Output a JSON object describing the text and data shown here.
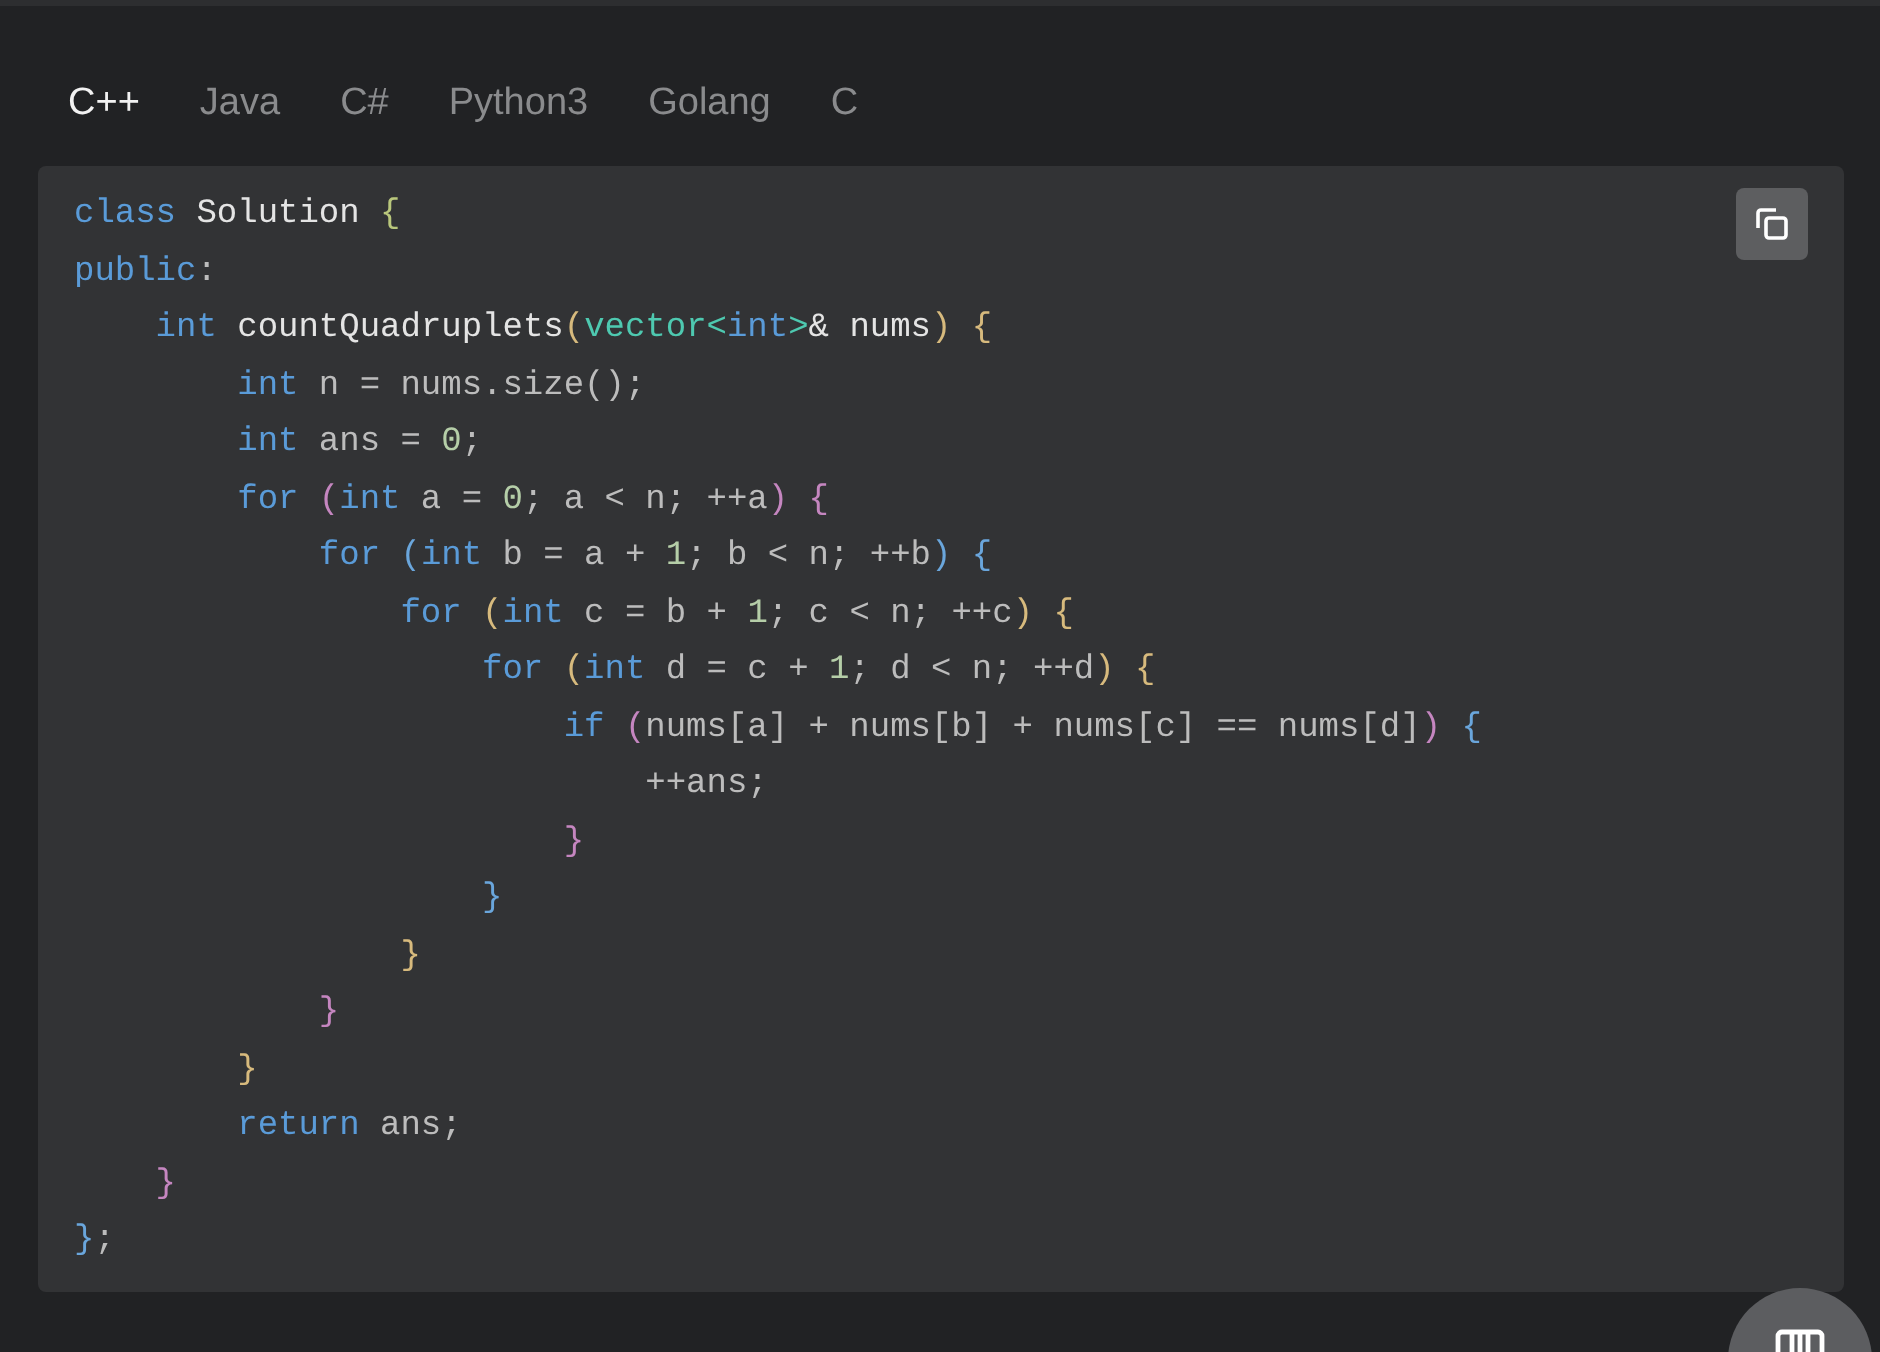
{
  "tabs": [
    {
      "label": "C++",
      "selected": true
    },
    {
      "label": "Java",
      "selected": false
    },
    {
      "label": "C#",
      "selected": false
    },
    {
      "label": "Python3",
      "selected": false
    },
    {
      "label": "Golang",
      "selected": false
    },
    {
      "label": "C",
      "selected": false
    }
  ],
  "code": {
    "lines": [
      [
        {
          "text": "class",
          "kind": "keyword"
        },
        {
          "text": " Solution ",
          "kind": "name"
        },
        {
          "text": "{",
          "kind": "bracket",
          "color": "#b9c77c"
        }
      ],
      [
        {
          "text": "public",
          "kind": "keyword"
        },
        {
          "text": ":",
          "kind": "text"
        }
      ],
      [
        {
          "text": "    int",
          "kind": "keyword"
        },
        {
          "text": " countQuadruplets",
          "kind": "name"
        },
        {
          "text": "(",
          "kind": "bracket",
          "color": "#d7ba7d"
        },
        {
          "text": "vector",
          "kind": "type"
        },
        {
          "text": "<",
          "kind": "type"
        },
        {
          "text": "int",
          "kind": "keyword"
        },
        {
          "text": ">",
          "kind": "type"
        },
        {
          "text": "& nums",
          "kind": "name"
        },
        {
          "text": ")",
          "kind": "bracket",
          "color": "#d7ba7d"
        },
        {
          "text": " {",
          "kind": "bracket",
          "color": "#d7ba7d"
        }
      ],
      [
        {
          "text": "        int",
          "kind": "keyword"
        },
        {
          "text": " n = nums.size();",
          "kind": "text"
        }
      ],
      [
        {
          "text": "        int",
          "kind": "keyword"
        },
        {
          "text": " ans = ",
          "kind": "text"
        },
        {
          "text": "0",
          "kind": "number"
        },
        {
          "text": ";",
          "kind": "text"
        }
      ],
      [
        {
          "text": "        for",
          "kind": "keyword"
        },
        {
          "text": " (",
          "kind": "bracket",
          "color": "#c586c0"
        },
        {
          "text": "int",
          "kind": "keyword"
        },
        {
          "text": " a = ",
          "kind": "text"
        },
        {
          "text": "0",
          "kind": "number"
        },
        {
          "text": "; a < n; ++a",
          "kind": "text"
        },
        {
          "text": ")",
          "kind": "bracket",
          "color": "#c586c0"
        },
        {
          "text": " {",
          "kind": "bracket",
          "color": "#c586c0"
        }
      ],
      [
        {
          "text": "            for",
          "kind": "keyword"
        },
        {
          "text": " (",
          "kind": "bracket",
          "color": "#6aa6dc"
        },
        {
          "text": "int",
          "kind": "keyword"
        },
        {
          "text": " b = a + ",
          "kind": "text"
        },
        {
          "text": "1",
          "kind": "number"
        },
        {
          "text": "; b < n; ++b",
          "kind": "text"
        },
        {
          "text": ")",
          "kind": "bracket",
          "color": "#6aa6dc"
        },
        {
          "text": " {",
          "kind": "bracket",
          "color": "#6aa6dc"
        }
      ],
      [
        {
          "text": "                for",
          "kind": "keyword"
        },
        {
          "text": " (",
          "kind": "bracket",
          "color": "#d7ba7d"
        },
        {
          "text": "int",
          "kind": "keyword"
        },
        {
          "text": " c = b + ",
          "kind": "text"
        },
        {
          "text": "1",
          "kind": "number"
        },
        {
          "text": "; c < n; ++c",
          "kind": "text"
        },
        {
          "text": ")",
          "kind": "bracket",
          "color": "#d7ba7d"
        },
        {
          "text": " {",
          "kind": "bracket",
          "color": "#d7ba7d"
        }
      ],
      [
        {
          "text": "                    for",
          "kind": "keyword"
        },
        {
          "text": " (",
          "kind": "bracket",
          "color": "#d7ba7d"
        },
        {
          "text": "int",
          "kind": "keyword"
        },
        {
          "text": " d = c + ",
          "kind": "text"
        },
        {
          "text": "1",
          "kind": "number"
        },
        {
          "text": "; d < n; ++d",
          "kind": "text"
        },
        {
          "text": ")",
          "kind": "bracket",
          "color": "#d7ba7d"
        },
        {
          "text": " {",
          "kind": "bracket",
          "color": "#d7ba7d"
        }
      ],
      [
        {
          "text": "                        if",
          "kind": "keyword"
        },
        {
          "text": " (",
          "kind": "bracket",
          "color": "#c586c0"
        },
        {
          "text": "nums[a] + nums[b] + nums[c] == nums[d]",
          "kind": "text"
        },
        {
          "text": ")",
          "kind": "bracket",
          "color": "#c586c0"
        },
        {
          "text": " {",
          "kind": "bracket",
          "color": "#6aa6dc"
        }
      ],
      [
        {
          "text": "                            ++ans;",
          "kind": "text"
        }
      ],
      [
        {
          "text": "                        }",
          "kind": "bracket",
          "color": "#c586c0"
        }
      ],
      [
        {
          "text": "                    }",
          "kind": "bracket",
          "color": "#6aa6dc"
        }
      ],
      [
        {
          "text": "                }",
          "kind": "bracket",
          "color": "#d7ba7d"
        }
      ],
      [
        {
          "text": "            }",
          "kind": "bracket",
          "color": "#c586c0"
        }
      ],
      [
        {
          "text": "        }",
          "kind": "bracket",
          "color": "#d7ba7d"
        }
      ],
      [
        {
          "text": "        return",
          "kind": "keyword"
        },
        {
          "text": " ans;",
          "kind": "text"
        }
      ],
      [
        {
          "text": "    }",
          "kind": "bracket",
          "color": "#c586c0"
        }
      ],
      [
        {
          "text": "}",
          "kind": "bracket",
          "color": "#6aa6dc"
        },
        {
          "text": ";",
          "kind": "text"
        }
      ]
    ]
  }
}
